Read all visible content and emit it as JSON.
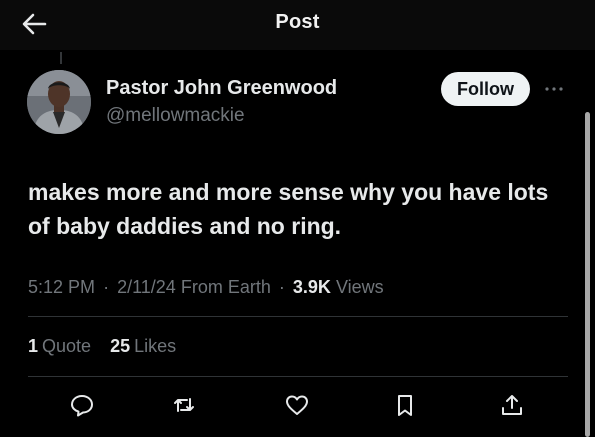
{
  "header": {
    "title": "Post",
    "back_icon": "arrow-left-icon"
  },
  "author": {
    "display_name": "Pastor John Greenwood",
    "handle": "@mellowmackie",
    "avatar": "avatar-photo"
  },
  "follow_button": {
    "label": "Follow"
  },
  "more_icon": "more-horizontal-icon",
  "post": {
    "text": "makes more and more sense why you have lots of baby daddies and no ring."
  },
  "meta": {
    "time": "5:12 PM",
    "separator": "·",
    "date": "2/11/24",
    "source": "From Earth",
    "views_count": "3.9K",
    "views_label": "Views"
  },
  "stats": {
    "quotes_count": "1",
    "quotes_label": "Quote",
    "likes_count": "25",
    "likes_label": "Likes"
  },
  "actions": [
    {
      "icon": "reply-icon"
    },
    {
      "icon": "repost-icon"
    },
    {
      "icon": "like-icon"
    },
    {
      "icon": "bookmark-icon"
    },
    {
      "icon": "share-icon"
    }
  ],
  "colors": {
    "background": "#000000",
    "text_primary": "#e7e9ea",
    "text_secondary": "#71767b",
    "follow_button_bg": "#eff3f4",
    "divider": "#2f3336"
  }
}
